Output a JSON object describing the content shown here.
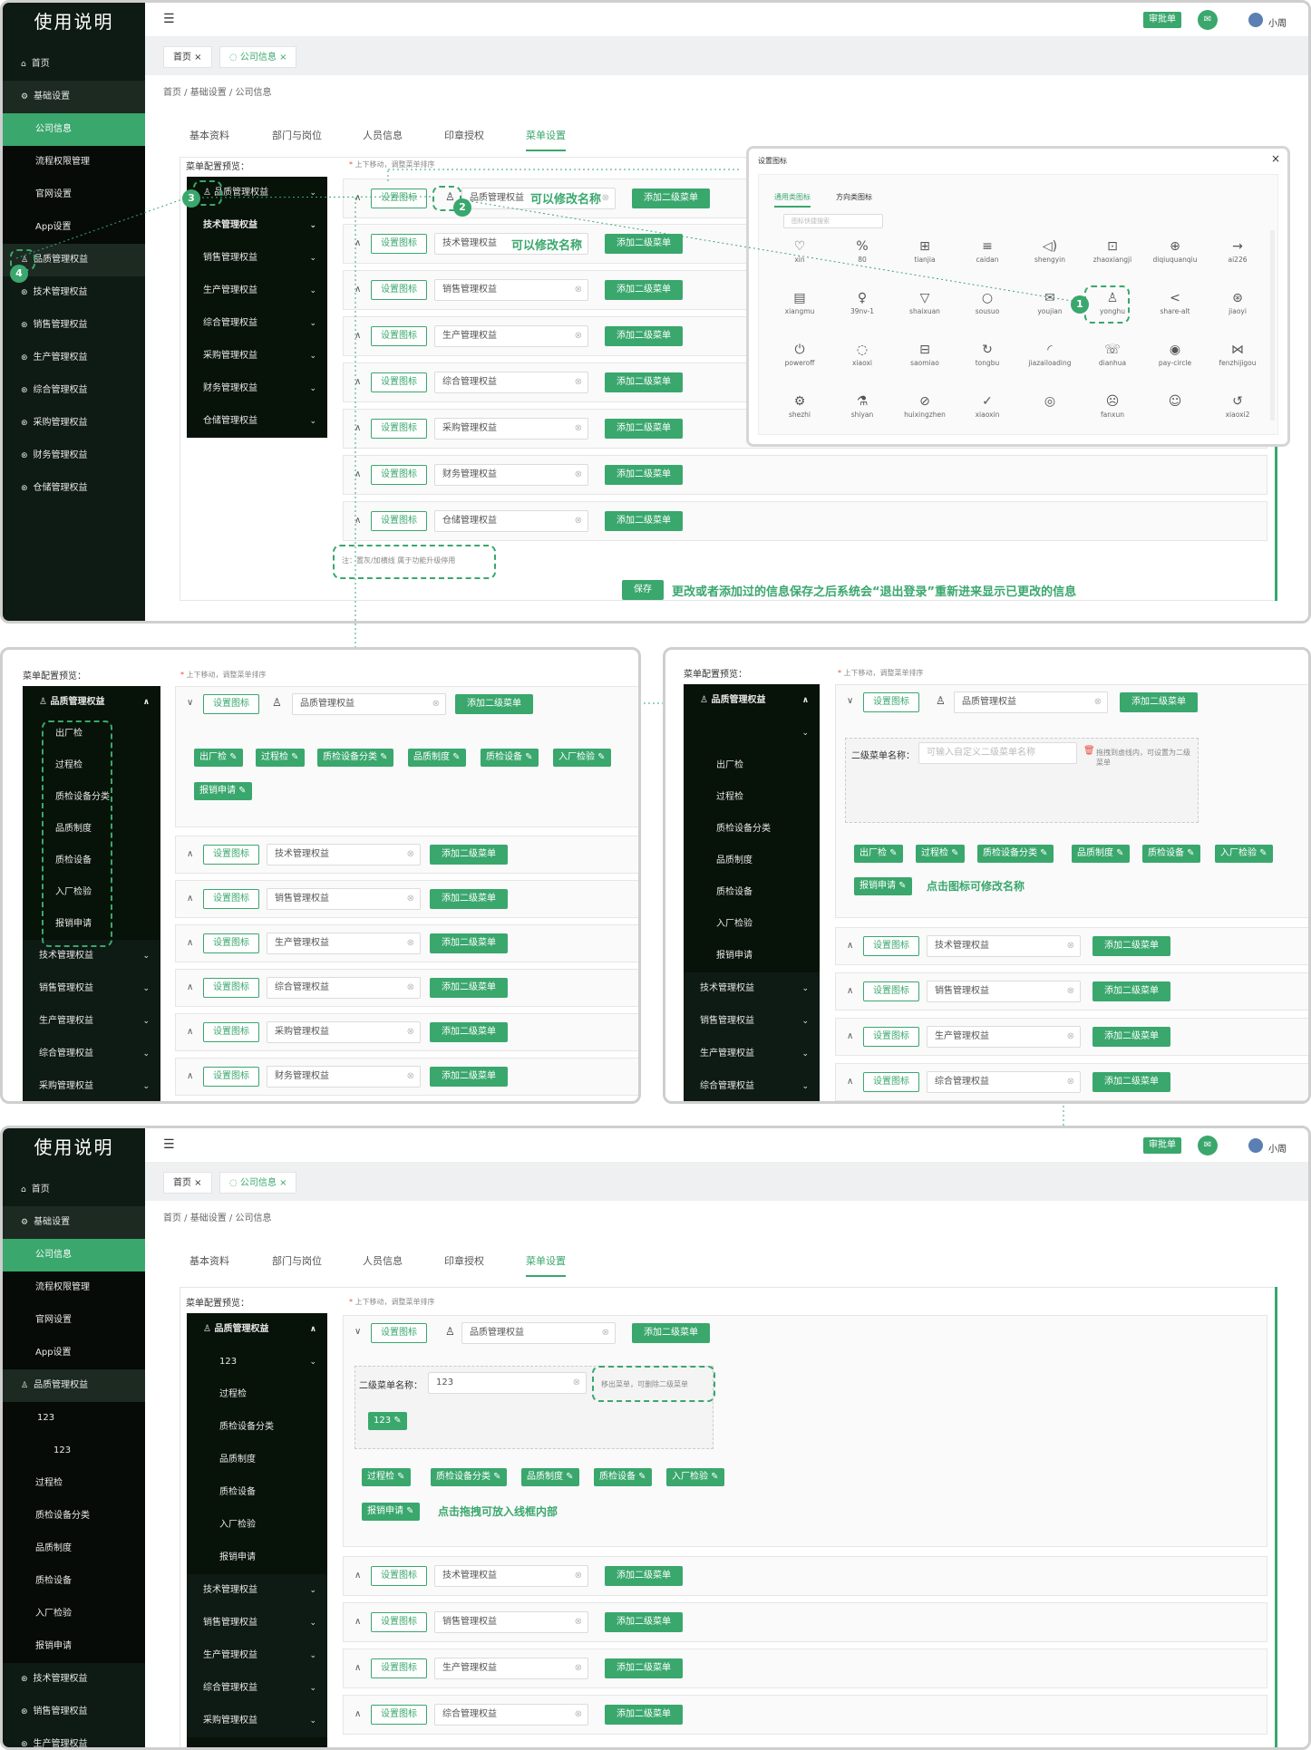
{
  "app": {
    "title": "使用说明",
    "topbar": {
      "approve": "审批单",
      "user": "小周"
    },
    "tabs": [
      "首页",
      "公司信息"
    ],
    "breadcrumb": "首页 / 基础设置 / 公司信息",
    "page_tabs": [
      "基本资料",
      "部门与岗位",
      "人员信息",
      "印章授权",
      "菜单设置"
    ],
    "nav": [
      "首页",
      "基础设置",
      "公司信息",
      "流程权限管理",
      "官网设置",
      "App设置",
      "品质管理权益",
      "技术管理权益",
      "销售管理权益",
      "生产管理权益",
      "综合管理权益",
      "采购管理权益",
      "财务管理权益",
      "仓储管理权益"
    ]
  },
  "menu": {
    "preview_label": "菜单配置预览：",
    "hint": "上下移动，调整菜单排序",
    "star": "*",
    "set_icon": "设置图标",
    "add_sub": "添加二级菜单",
    "save": "保存",
    "items": [
      "品质管理权益",
      "技术管理权益",
      "销售管理权益",
      "生产管理权益",
      "综合管理权益",
      "采购管理权益",
      "财务管理权益",
      "仓储管理权益"
    ],
    "note": "注：置灰/加横线 属于功能升级停用"
  },
  "notes": {
    "edit_name": "可以修改名称",
    "save_msg": "更改或者添加过的信息保存之后系统会“退出登录”重新进来显示已更改的信息",
    "click_icon": "点击图标可修改名称",
    "drag": "点击拖拽可放入线框内部"
  },
  "icon_dialog": {
    "title": "设置图标",
    "close": "×",
    "tabs": [
      "通用类图标",
      "方向类图标"
    ],
    "search": "图标快捷搜索",
    "icons": [
      "xin",
      "80",
      "tianjia",
      "caidan",
      "shengyin",
      "zhaoxiangji",
      "diqiuquanqiu",
      "ai226",
      "xiangmu",
      "39nv-1",
      "shaixuan",
      "sousuo",
      "youjian",
      "yonghu",
      "share-alt",
      "jiaoyi",
      "poweroff",
      "xiaoxi",
      "saomiao",
      "tongbu",
      "jiazailoading",
      "dianhua",
      "pay-circle",
      "fenzhijigou",
      "shezhi",
      "shiyan",
      "huixingzhen",
      "xiaoxin",
      "",
      "fanxun",
      "",
      "xiaoxi2"
    ],
    "glyphs": [
      "♡",
      "%",
      "⊞",
      "≡",
      "◁)",
      "⊡",
      "⊕",
      "→",
      "▤",
      "♀",
      "▽",
      "○",
      "✉",
      "♙",
      "<",
      "⊛",
      "⏻",
      "◌",
      "⊟",
      "↻",
      "◜",
      "☏",
      "◉",
      "⋈",
      "⚙",
      "⚗",
      "⊘",
      "✓",
      "◎",
      "☹",
      "☺",
      "↺"
    ]
  },
  "subs": [
    "出厂检",
    "过程检",
    "质检设备分类",
    "品质制度",
    "质检设备",
    "入厂检验",
    "报销申请"
  ],
  "sub_form": {
    "label": "二级菜单名称：",
    "placeholder": "可输入自定义二级菜单名称",
    "hint": "拖拽到虚线内，可设置为二级菜单",
    "value": "123",
    "remove_hint": "移出菜单，可删除二级菜单"
  },
  "badges": [
    "1",
    "2",
    "3",
    "4"
  ]
}
